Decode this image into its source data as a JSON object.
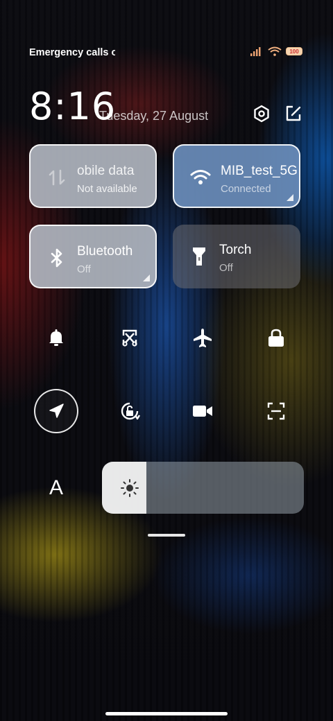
{
  "status_bar": {
    "carrier_text": "Emergency calls o",
    "icons": [
      "signal-icon",
      "wifi-icon",
      "battery-icon"
    ],
    "battery_level": "100"
  },
  "header": {
    "time": "8:16",
    "date": "Tuesday, 27 August",
    "icons": [
      "settings-icon",
      "edit-icon"
    ]
  },
  "tiles": [
    {
      "title": "obile data",
      "subtitle": "Not available",
      "icon": "mobile-data-icon",
      "state": "unavailable"
    },
    {
      "title": "MIB_test_5G",
      "subtitle": "Connected",
      "icon": "wifi-icon",
      "state": "on"
    },
    {
      "title": "Bluetooth",
      "subtitle": "Off",
      "icon": "bluetooth-icon",
      "state": "off"
    },
    {
      "title": "Torch",
      "subtitle": "Off",
      "icon": "torch-icon",
      "state": "off"
    }
  ],
  "quick_toggles": [
    {
      "icon": "bell-icon"
    },
    {
      "icon": "screenshot-icon"
    },
    {
      "icon": "airplane-icon"
    },
    {
      "icon": "lock-icon"
    },
    {
      "icon": "location-icon",
      "state": "on"
    },
    {
      "icon": "rotation-lock-icon"
    },
    {
      "icon": "video-camera-icon"
    },
    {
      "icon": "scan-icon"
    }
  ],
  "reading_mode": {
    "label": "A",
    "icon": "font-size-icon"
  },
  "brightness": {
    "level": 0.22,
    "icon": "sun-icon"
  },
  "colors": {
    "wifi_tile": "#698cb9",
    "tile_light": "#afb4be"
  }
}
